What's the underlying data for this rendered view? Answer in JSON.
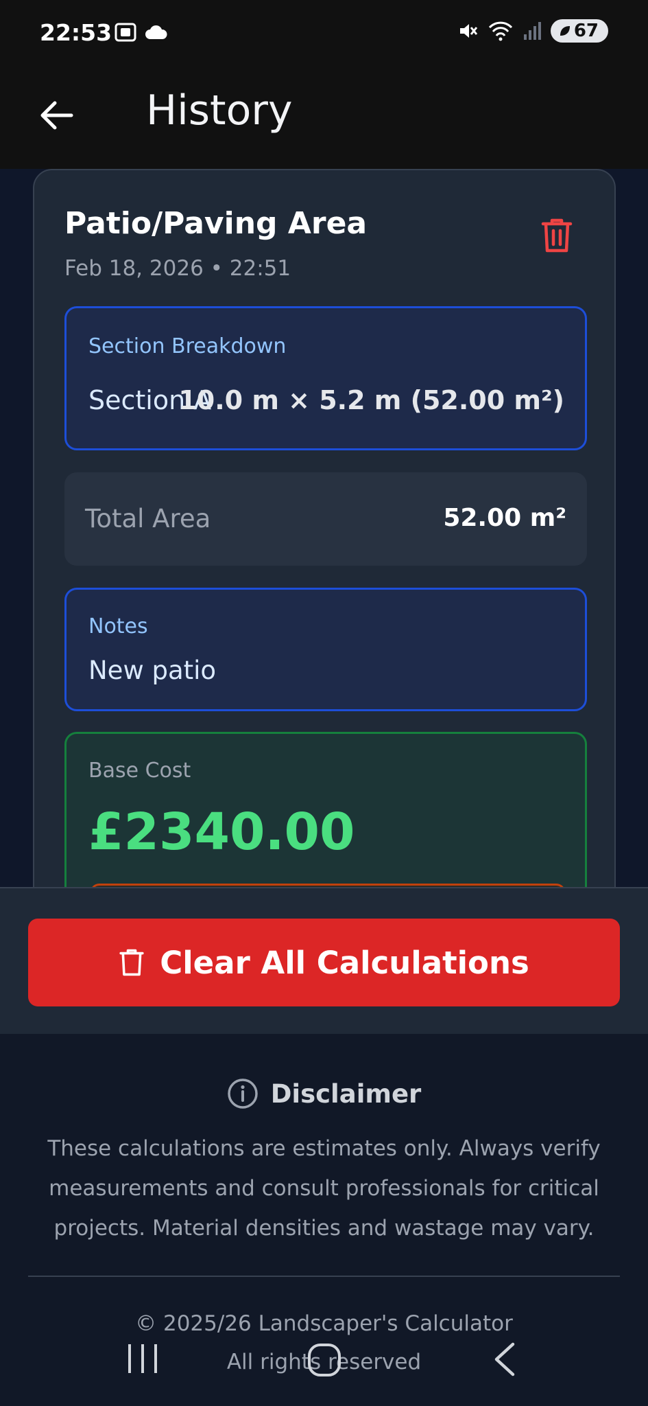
{
  "status_bar": {
    "time": "22:53",
    "battery": "67",
    "icons": [
      "screenshot-icon",
      "cloud-icon",
      "mute-icon",
      "wifi-icon",
      "signal-icon",
      "battery-icon"
    ]
  },
  "app_bar": {
    "title": "History",
    "back_icon": "arrow-left-icon"
  },
  "calculation": {
    "title": "Patio/Paving Area",
    "date": "Feb 18, 2026 • 22:51",
    "delete_icon": "trash-icon",
    "breakdown": {
      "title": "Section Breakdown",
      "sections": [
        {
          "name": "Section A",
          "value": "10.0 m × 5.2 m (52.00 m²)"
        }
      ]
    },
    "total": {
      "label": "Total Area",
      "value": "52.00 m²"
    },
    "notes": {
      "title": "Notes",
      "text": "New patio"
    },
    "cost": {
      "title": "Base Cost",
      "value": "£2340.00"
    }
  },
  "actions": {
    "clear_all_label": "Clear All Calculations",
    "clear_icon": "trash-icon"
  },
  "footer": {
    "disclaimer_title": "Disclaimer",
    "disclaimer_icon": "info-icon",
    "disclaimer_text": "These calculations are estimates only. Always verify measurements and consult professionals for critical projects. Material densities and wastage may vary.",
    "copyright": "© 2025/26 Landscaper's Calculator",
    "rights": "All rights reserved"
  },
  "colors": {
    "background": "#111827",
    "card": "#1f2937",
    "accent_blue": "#1d4ed8",
    "accent_green": "#4ade80",
    "danger": "#dc2626"
  }
}
